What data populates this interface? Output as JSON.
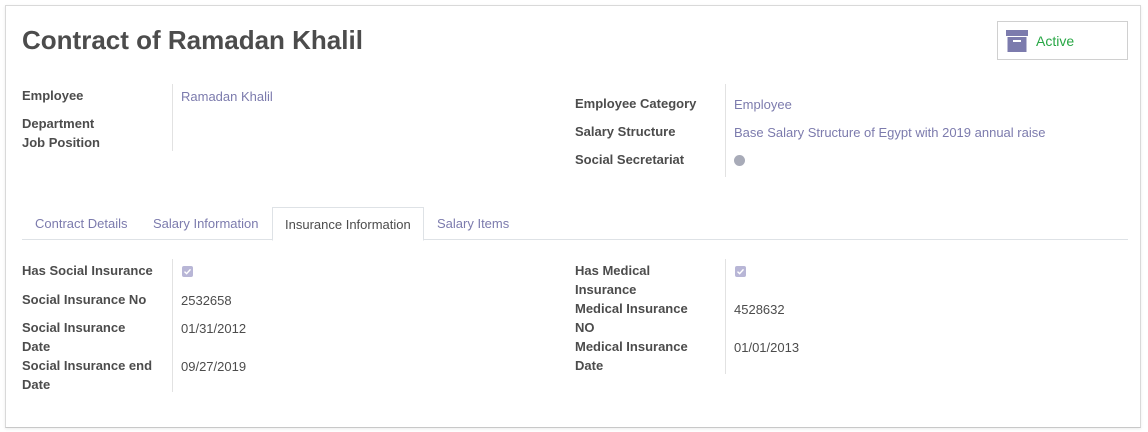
{
  "title": "Contract of Ramadan Khalil",
  "status": {
    "label": "Active",
    "icon": "archive-icon",
    "color": "#28a745"
  },
  "header_left": {
    "employee_label": "Employee",
    "employee_value": "Ramadan Khalil",
    "department_label": "Department",
    "job_position_label": "Job Position"
  },
  "header_right": {
    "category_label": "Employee Category",
    "category_value": "Employee",
    "structure_label": "Salary Structure",
    "structure_value": "Base Salary Structure of Egypt with 2019 annual raise",
    "secretariat_label": "Social Secretariat"
  },
  "tabs": [
    {
      "label": "Contract Details",
      "active": false
    },
    {
      "label": "Salary Information",
      "active": false
    },
    {
      "label": "Insurance Information",
      "active": true
    },
    {
      "label": "Salary Items",
      "active": false
    }
  ],
  "insurance_left": {
    "has_social_label": "Has Social Insurance",
    "has_social_checked": true,
    "social_no_label": "Social Insurance No",
    "social_no_value": "2532658",
    "social_date_label": "Social Insurance Date",
    "social_date_value": "01/31/2012",
    "social_end_label": "Social Insurance end Date",
    "social_end_value": "09/27/2019"
  },
  "insurance_right": {
    "has_medical_label": "Has Medical Insurance",
    "has_medical_checked": true,
    "medical_no_label": "Medical Insurance NO",
    "medical_no_value": "4528632",
    "medical_date_label": "Medical Insurance Date",
    "medical_date_value": "01/01/2013"
  },
  "colors": {
    "link": "#7c7bad",
    "text": "#4c4c4c",
    "checkbox": "#b8b6d6"
  }
}
